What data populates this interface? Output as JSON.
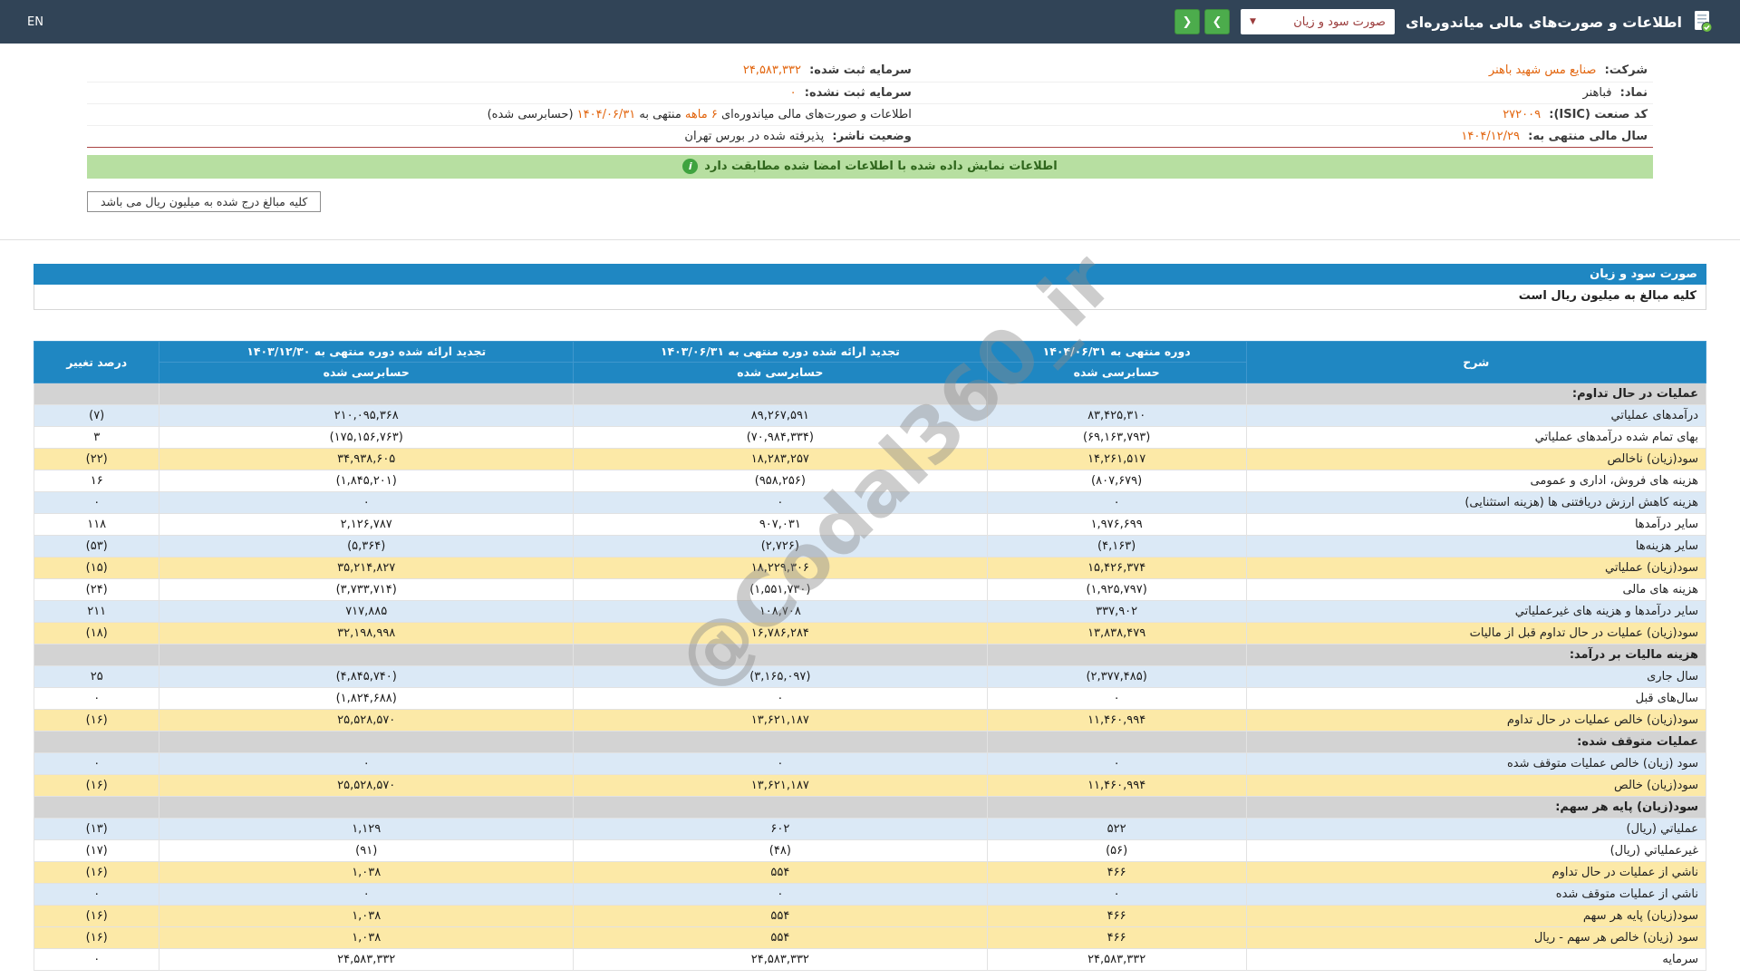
{
  "topbar": {
    "title": "اطلاعات و صورت‌های مالی میاندوره‌ای",
    "report_dropdown": "صورت سود و زیان",
    "en_label": "EN"
  },
  "icons": {
    "info": "i",
    "nav_back": "❮",
    "nav_forward": "❯",
    "caret": "▼"
  },
  "company": {
    "rows": [
      {
        "r_label": "شرکت:",
        "r_value": "صنایع مس شهید باهنر",
        "l_label": "سرمایه ثبت شده:",
        "l_value": "۲۴,۵۸۳,۳۳۲"
      },
      {
        "r_label": "نماد:",
        "r_value": "فباهنر",
        "l_label": "سرمایه ثبت نشده:",
        "l_value": "۰"
      },
      {
        "r_label": "کد صنعت (ISIC):",
        "r_value": "۲۷۲۰۰۹",
        "l_prefix": "اطلاعات و صورت‌های مالی میاندوره‌ای",
        "l_highlight": "۶ ماهه",
        "l_mid": "منتهی به",
        "l_date": "۱۴۰۴/۰۶/۳۱",
        "l_suffix": "(حسابرسی شده)"
      },
      {
        "r_label": "سال مالی منتهی به:",
        "r_value": "۱۴۰۴/۱۲/۲۹",
        "l_label": "وضعیت ناشر:",
        "l_value": "پذیرفته شده در بورس تهران"
      }
    ]
  },
  "notice": {
    "text": "اطلاعات نمایش داده شده با اطلاعات امضا شده مطابقت دارد"
  },
  "unit_box": "کلیه مبالغ درج شده به میلیون ریال می باشد",
  "statement": {
    "title": "صورت سود و زیان",
    "subtitle": "کلیه مبالغ به میلیون ریال است",
    "watermark": "@Codal360_ir",
    "columns": {
      "desc": "شرح",
      "p1": "دوره منتهی به ۱۴۰۴/۰۶/۳۱",
      "p2": "تجدید ارائه شده دوره منتهی به ۱۴۰۳/۰۶/۳۱",
      "p3": "تجدید ارائه شده دوره منتهی به ۱۴۰۳/۱۲/۳۰",
      "audited": "حسابرسی شده",
      "change": "درصد تغییر"
    },
    "rows": [
      {
        "type": "section",
        "desc": "عملیات در حال تداوم:"
      },
      {
        "type": "data",
        "style": "blue",
        "desc": "درآمدهای عملیاتي",
        "v1": "۸۳,۴۲۵,۳۱۰",
        "v2": "۸۹,۲۶۷,۵۹۱",
        "v3": "۲۱۰,۰۹۵,۳۶۸",
        "chg": "(۷)"
      },
      {
        "type": "data",
        "style": "white",
        "desc": "بهای تمام شده درآمدهای عملیاتي",
        "v1": "(۶۹,۱۶۳,۷۹۳)",
        "v2": "(۷۰,۹۸۴,۳۳۴)",
        "v3": "(۱۷۵,۱۵۶,۷۶۳)",
        "chg": "۳"
      },
      {
        "type": "data",
        "style": "yellow",
        "desc": "سود(زیان) ناخالص",
        "v1": "۱۴,۲۶۱,۵۱۷",
        "v2": "۱۸,۲۸۳,۲۵۷",
        "v3": "۳۴,۹۳۸,۶۰۵",
        "chg": "(۲۲)"
      },
      {
        "type": "data",
        "style": "white",
        "desc": "هزینه های فروش، اداری و عمومی",
        "v1": "(۸۰۷,۶۷۹)",
        "v2": "(۹۵۸,۲۵۶)",
        "v3": "(۱,۸۴۵,۲۰۱)",
        "chg": "۱۶"
      },
      {
        "type": "data",
        "style": "blue",
        "desc": "هزینه کاهش ارزش دریافتنی ها (هزینه استثنایی)",
        "v1": "۰",
        "v2": "۰",
        "v3": "۰",
        "chg": "۰"
      },
      {
        "type": "data",
        "style": "white",
        "desc": "سایر درآمدها",
        "v1": "۱,۹۷۶,۶۹۹",
        "v2": "۹۰۷,۰۳۱",
        "v3": "۲,۱۲۶,۷۸۷",
        "chg": "۱۱۸"
      },
      {
        "type": "data",
        "style": "blue",
        "desc": "سایر هزینه‌ها",
        "v1": "(۴,۱۶۳)",
        "v2": "(۲,۷۲۶)",
        "v3": "(۵,۳۶۴)",
        "chg": "(۵۳)"
      },
      {
        "type": "data",
        "style": "yellow",
        "desc": "سود(زیان) عملیاتي",
        "v1": "۱۵,۴۲۶,۳۷۴",
        "v2": "۱۸,۲۲۹,۳۰۶",
        "v3": "۳۵,۲۱۴,۸۲۷",
        "chg": "(۱۵)"
      },
      {
        "type": "data",
        "style": "white",
        "desc": "هزینه های مالی",
        "v1": "(۱,۹۲۵,۷۹۷)",
        "v2": "(۱,۵۵۱,۷۳۰)",
        "v3": "(۳,۷۳۳,۷۱۴)",
        "chg": "(۲۴)"
      },
      {
        "type": "data",
        "style": "blue",
        "desc": "سایر درآمدها و هزینه های غیرعملیاتي",
        "v1": "۳۳۷,۹۰۲",
        "v2": "۱۰۸,۷۰۸",
        "v3": "۷۱۷,۸۸۵",
        "chg": "۲۱۱"
      },
      {
        "type": "data",
        "style": "yellow",
        "desc": "سود(زیان) عملیات در حال تداوم قبل از مالیات",
        "v1": "۱۳,۸۳۸,۴۷۹",
        "v2": "۱۶,۷۸۶,۲۸۴",
        "v3": "۳۲,۱۹۸,۹۹۸",
        "chg": "(۱۸)"
      },
      {
        "type": "section",
        "desc": "هزینه مالیات بر درآمد:"
      },
      {
        "type": "data",
        "style": "blue",
        "desc": "سال جاری",
        "v1": "(۲,۳۷۷,۴۸۵)",
        "v2": "(۳,۱۶۵,۰۹۷)",
        "v3": "(۴,۸۴۵,۷۴۰)",
        "chg": "۲۵"
      },
      {
        "type": "data",
        "style": "white",
        "desc": "سال‌های قبل",
        "v1": "۰",
        "v2": "۰",
        "v3": "(۱,۸۲۴,۶۸۸)",
        "chg": "۰"
      },
      {
        "type": "data",
        "style": "yellow",
        "desc": "سود(زیان) خالص عملیات در حال تداوم",
        "v1": "۱۱,۴۶۰,۹۹۴",
        "v2": "۱۳,۶۲۱,۱۸۷",
        "v3": "۲۵,۵۲۸,۵۷۰",
        "chg": "(۱۶)"
      },
      {
        "type": "section",
        "desc": "عملیات متوقف شده:"
      },
      {
        "type": "data",
        "style": "blue",
        "desc": "سود (زیان) خالص عملیات متوقف شده",
        "v1": "۰",
        "v2": "۰",
        "v3": "۰",
        "chg": "۰"
      },
      {
        "type": "data",
        "style": "yellow",
        "desc": "سود(زیان) خالص",
        "v1": "۱۱,۴۶۰,۹۹۴",
        "v2": "۱۳,۶۲۱,۱۸۷",
        "v3": "۲۵,۵۲۸,۵۷۰",
        "chg": "(۱۶)"
      },
      {
        "type": "section",
        "desc": "سود(زیان) پایه هر سهم:"
      },
      {
        "type": "data",
        "style": "blue",
        "desc": "عملیاتي (ریال)",
        "v1": "۵۲۲",
        "v2": "۶۰۲",
        "v3": "۱,۱۲۹",
        "chg": "(۱۳)"
      },
      {
        "type": "data",
        "style": "white",
        "desc": "غیرعملیاتي (ریال)",
        "v1": "(۵۶)",
        "v2": "(۴۸)",
        "v3": "(۹۱)",
        "chg": "(۱۷)"
      },
      {
        "type": "data",
        "style": "yellow",
        "desc": "ناشي از عملیات در حال تداوم",
        "v1": "۴۶۶",
        "v2": "۵۵۴",
        "v3": "۱,۰۳۸",
        "chg": "(۱۶)"
      },
      {
        "type": "data",
        "style": "blue",
        "desc": "ناشي از عملیات متوقف شده",
        "v1": "۰",
        "v2": "۰",
        "v3": "۰",
        "chg": "۰"
      },
      {
        "type": "data",
        "style": "yellow",
        "desc": "سود(زیان) پایه هر سهم",
        "v1": "۴۶۶",
        "v2": "۵۵۴",
        "v3": "۱,۰۳۸",
        "chg": "(۱۶)"
      },
      {
        "type": "data",
        "style": "yellow",
        "desc": "سود (زیان) خالص هر سهم - ریال",
        "v1": "۴۶۶",
        "v2": "۵۵۴",
        "v3": "۱,۰۳۸",
        "chg": "(۱۶)"
      },
      {
        "type": "data",
        "style": "white",
        "desc": "سرمایه",
        "v1": "۲۴,۵۸۳,۳۳۲",
        "v2": "۲۴,۵۸۳,۳۳۲",
        "v3": "۲۴,۵۸۳,۳۳۲",
        "chg": "۰"
      }
    ]
  }
}
